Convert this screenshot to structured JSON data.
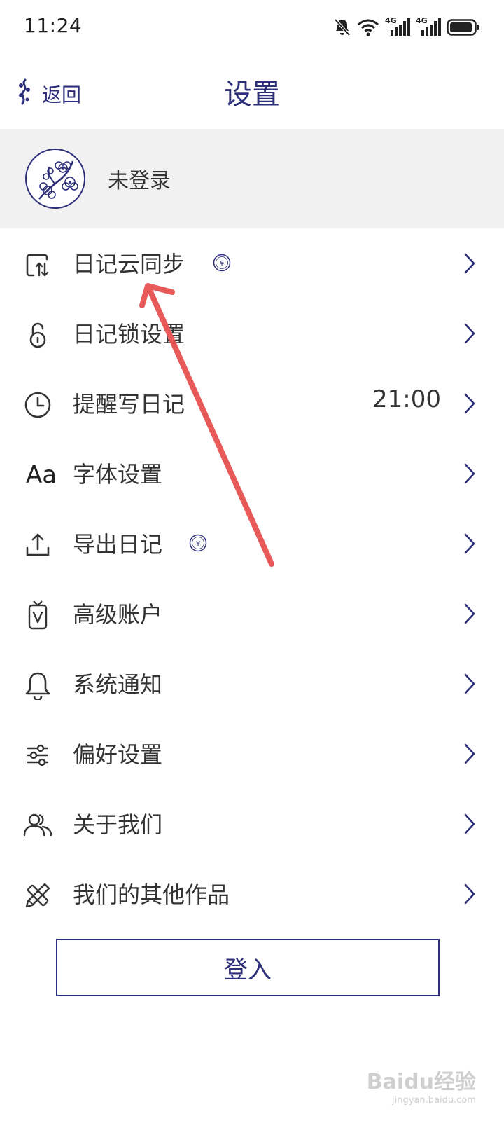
{
  "status_bar": {
    "time": "11:24",
    "network_label_1": "4G",
    "network_label_2": "4G",
    "icons": [
      "mute-bell-icon",
      "wifi-icon",
      "signal-4g-icon",
      "signal-4g-icon",
      "battery-icon"
    ]
  },
  "nav": {
    "back_label": "返回",
    "title": "设置"
  },
  "profile": {
    "name": "未登录"
  },
  "settings": [
    {
      "label": "日记云同步",
      "icon": "cloud-sync-icon",
      "premium": true,
      "value": ""
    },
    {
      "label": "日记锁设置",
      "icon": "lock-icon",
      "premium": false,
      "value": ""
    },
    {
      "label": "提醒写日记",
      "icon": "clock-icon",
      "premium": false,
      "value": "21:00"
    },
    {
      "label": "字体设置",
      "icon": "font-icon",
      "premium": false,
      "value": ""
    },
    {
      "label": "导出日记",
      "icon": "export-icon",
      "premium": true,
      "value": ""
    },
    {
      "label": "高级账户",
      "icon": "vip-icon",
      "premium": false,
      "value": ""
    },
    {
      "label": "系统通知",
      "icon": "bell-icon",
      "premium": false,
      "value": ""
    },
    {
      "label": "偏好设置",
      "icon": "sliders-icon",
      "premium": false,
      "value": ""
    },
    {
      "label": "关于我们",
      "icon": "people-icon",
      "premium": false,
      "value": ""
    },
    {
      "label": "我们的其他作品",
      "icon": "pencil-ruler-icon",
      "premium": false,
      "value": ""
    }
  ],
  "font_icon_text": "Aa",
  "coin_symbol": "¥",
  "login_button": "登入",
  "colors": {
    "accent": "#2e2f7a",
    "profile_bg": "#f1f1f1",
    "annotation_arrow": "#e85a5a"
  },
  "watermark": {
    "main": "Baidu经验",
    "sub": "jingyan.baidu.com"
  }
}
